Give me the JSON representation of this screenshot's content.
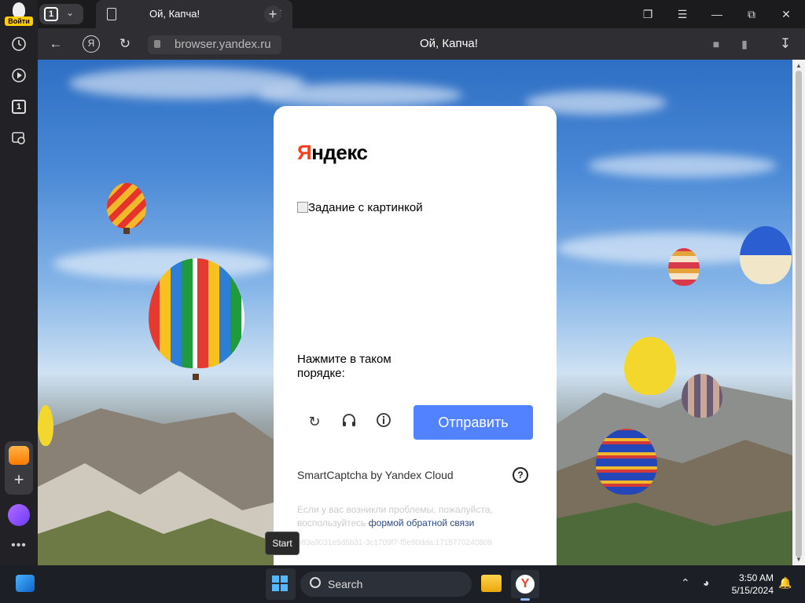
{
  "sidebar": {
    "login_label": "Войти",
    "tab_count": "1"
  },
  "tabs": {
    "counter": "1",
    "active_title": "Ой, Капча!"
  },
  "addressbar": {
    "url": "browser.yandex.ru",
    "page_title": "Ой, Капча!"
  },
  "captcha": {
    "logo_first": "Я",
    "logo_rest": "ндекс",
    "image_alt": "Задание с картинкой",
    "instruction": "Нажмите в таком порядке:",
    "submit_label": "Отправить",
    "brand": "SmartCaptcha by Yandex Cloud",
    "help_label": "?",
    "note_text": "Если у вас возникли проблемы, пожалуйста, воспользуйтесь",
    "note_link": "формой обратной связи",
    "request_id": "383a9031e5d5b31-3c1709f7-f5e90dda:1715770240809"
  },
  "tooltip": "Start",
  "taskbar": {
    "search_label": "Search",
    "time": "3:50 AM",
    "date": "5/15/2024"
  },
  "colors": {
    "accent": "#5282ff",
    "brand_red": "#fc3f1d",
    "link": "#2b4a8c"
  }
}
